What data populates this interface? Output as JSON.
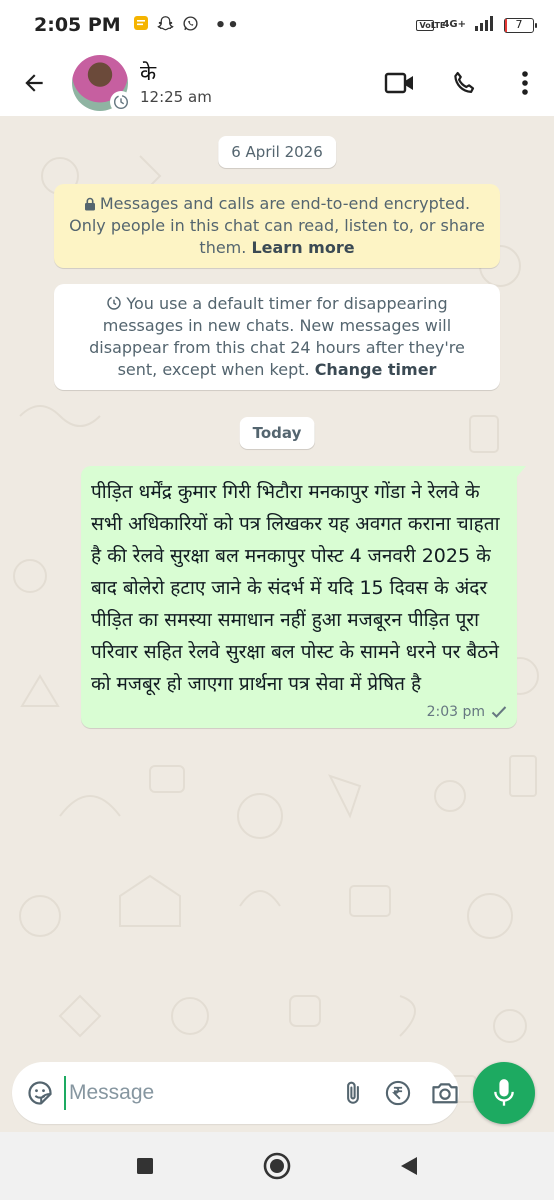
{
  "status_bar": {
    "time": "2:05 PM",
    "more": "••",
    "network": "4G+",
    "volte": "VoLTE",
    "battery_level": "7",
    "battery_fraction": 0.07
  },
  "header": {
    "contact_name": "के",
    "subtitle": "12:25 am",
    "icons": [
      "back-arrow-icon",
      "video-call-icon",
      "voice-call-icon",
      "more-vert-icon"
    ]
  },
  "chat": {
    "date_chip": "6 April 2026",
    "encryption_notice": {
      "text": "Messages and calls are end-to-end encrypted. Only people in this chat can read, listen to, or share them.",
      "link": "Learn more"
    },
    "timer_notice": {
      "text": "You use a default timer for disappearing messages in new chats. New messages will disappear from this chat 24 hours after they're sent, except when kept.",
      "link": "Change timer"
    },
    "today_chip": "Today",
    "messages": [
      {
        "direction": "outgoing",
        "text": "पीड़ित धर्मेंद्र कुमार गिरी भिटौरा मनकापुर गोंडा ने रेलवे के सभी अधिकारियों को पत्र लिखकर यह अवगत कराना चाहता है की रेलवे सुरक्षा बल मनकापुर पोस्ट 4 जनवरी 2025 के बाद बोलेरो हटाए जाने के संदर्भ में यदि 15 दिवस के अंदर पीड़ित का समस्या समाधान नहीं हुआ मजबूरन पीड़ित पूरा परिवार सहित रेलवे सुरक्षा बल पोस्ट के सामने धरने पर बैठने को मजबूर हो जाएगा प्रार्थना पत्र सेवा में प्रेषित है",
        "time": "2:03 pm",
        "status": "sent"
      }
    ]
  },
  "composer": {
    "placeholder": "Message",
    "icons": [
      "sticker-icon",
      "attach-icon",
      "rupee-payment-icon",
      "camera-icon",
      "mic-icon"
    ]
  },
  "colors": {
    "chat_bg": "#efeae2",
    "outgoing_bubble": "#d9fdd3",
    "encryption_bg": "#fdf4c5",
    "accent_green": "#1daa61"
  }
}
